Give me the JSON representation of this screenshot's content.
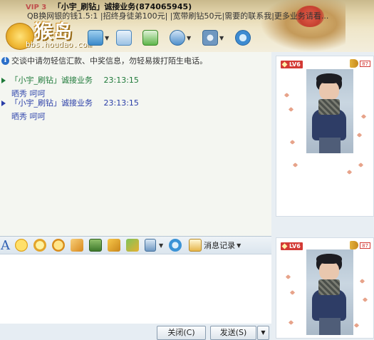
{
  "window": {
    "vip_badge": "VIP 3",
    "title": "「小宇_刷钻」诚接业务(874065945)",
    "signature": "QB换网银的钱1.5:1 |招终身徒弟100元| |宽带刷钻50元|需要的联系我|更多业务请看..."
  },
  "logo": {
    "text": "猴岛",
    "url": "bbs.houdao.com"
  },
  "toolbar": {
    "icons": [
      "video-chat-icon",
      "voice-chat-icon",
      "send-file-icon",
      "email-icon",
      "add-app-icon",
      "group-icon",
      "settings-icon",
      "search-icon"
    ]
  },
  "chat": {
    "notice": "交谈中请勿轻信汇款、中奖信息，勿轻易拨打陌生电话。",
    "messages": [
      {
        "sender": "「小宇_刷钻」诚接业务",
        "time": "23:13:15",
        "text": "晒秀 呵呵",
        "color": "#1f7a3a"
      },
      {
        "sender": "「小宇_刷钻」诚接业务",
        "time": "23:13:15",
        "text": "晒秀 呵呵",
        "color": "#2a3ea8"
      }
    ]
  },
  "input_toolbar": {
    "font_label": "A",
    "history_label": "消息记录"
  },
  "buttons": {
    "close_label": "关闭(C)",
    "send_label": "发送(S)"
  },
  "profile_cards": [
    {
      "level": "LV6",
      "volume": "87"
    },
    {
      "level": "LV6",
      "volume": "87"
    }
  ]
}
